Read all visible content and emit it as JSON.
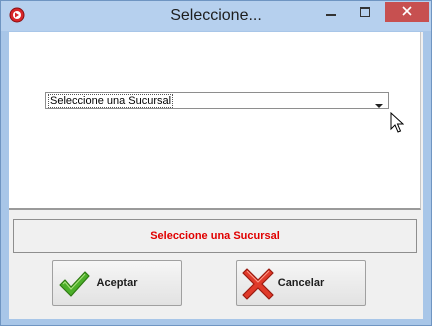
{
  "window": {
    "title": "Seleccione..."
  },
  "combo": {
    "value": "Seleccione una Sucursal"
  },
  "status": {
    "message": "Seleccione una Sucursal",
    "color": "#e00000"
  },
  "buttons": {
    "accept_label": "Aceptar",
    "cancel_label": "Cancelar"
  },
  "icons": {
    "app": "app-icon",
    "minimize": "minimize-icon",
    "maximize": "maximize-icon",
    "close": "close-icon",
    "dropdown": "chevron-down-icon",
    "accept": "checkmark-icon",
    "cancel": "red-x-icon",
    "cursor": "mouse-cursor-icon"
  },
  "colors": {
    "titlebar": "#b6d0ee",
    "close_button": "#c75050"
  }
}
